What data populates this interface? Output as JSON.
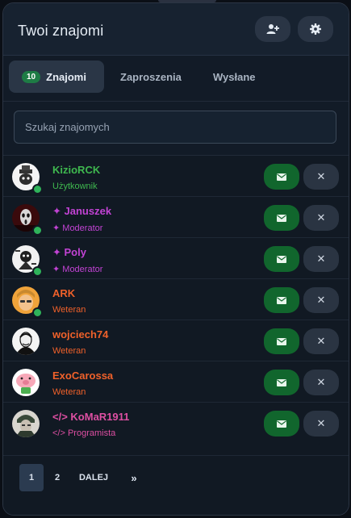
{
  "header": {
    "title": "Twoi znajomi",
    "add_icon": "user-plus-icon",
    "settings_icon": "gear-icon"
  },
  "tabs": [
    {
      "label": "Znajomi",
      "count": "10",
      "active": true
    },
    {
      "label": "Zaproszenia",
      "active": false
    },
    {
      "label": "Wysłane",
      "active": false
    }
  ],
  "search": {
    "placeholder": "Szukaj znajomych",
    "value": ""
  },
  "friends": [
    {
      "name": "KizioRCK",
      "role": "Użytkownik",
      "name_color": "#3fb84f",
      "role_color": "#3fb84f",
      "online": true,
      "prefix": ""
    },
    {
      "name": "Januszek",
      "role": "Moderator",
      "name_color": "#c243d4",
      "role_color": "#c243d4",
      "online": true,
      "prefix": "✦ "
    },
    {
      "name": "Poly",
      "role": "Moderator",
      "name_color": "#c243d4",
      "role_color": "#c243d4",
      "online": true,
      "prefix": "✦ "
    },
    {
      "name": "ARK",
      "role": "Weteran",
      "name_color": "#f0612a",
      "role_color": "#f0612a",
      "online": true,
      "prefix": ""
    },
    {
      "name": "wojciech74",
      "role": "Weteran",
      "name_color": "#f0612a",
      "role_color": "#f0612a",
      "online": false,
      "prefix": ""
    },
    {
      "name": "ExoCarossa",
      "role": "Weteran",
      "name_color": "#f0612a",
      "role_color": "#f0612a",
      "online": false,
      "prefix": ""
    },
    {
      "name": "KoMaR1911",
      "role": "Programista",
      "name_color": "#dd4fa2",
      "role_color": "#dd4fa2",
      "online": false,
      "prefix": "</> "
    }
  ],
  "row_actions": {
    "message_icon": "envelope-icon",
    "remove_label": "✕"
  },
  "pagination": {
    "pages": [
      "1",
      "2"
    ],
    "current": "1",
    "next_label": "DALEJ",
    "last_label": "»"
  },
  "colors": {
    "accent_green": "#11662d",
    "badge_green": "#1e7c45",
    "panel_bg": "#111923"
  }
}
